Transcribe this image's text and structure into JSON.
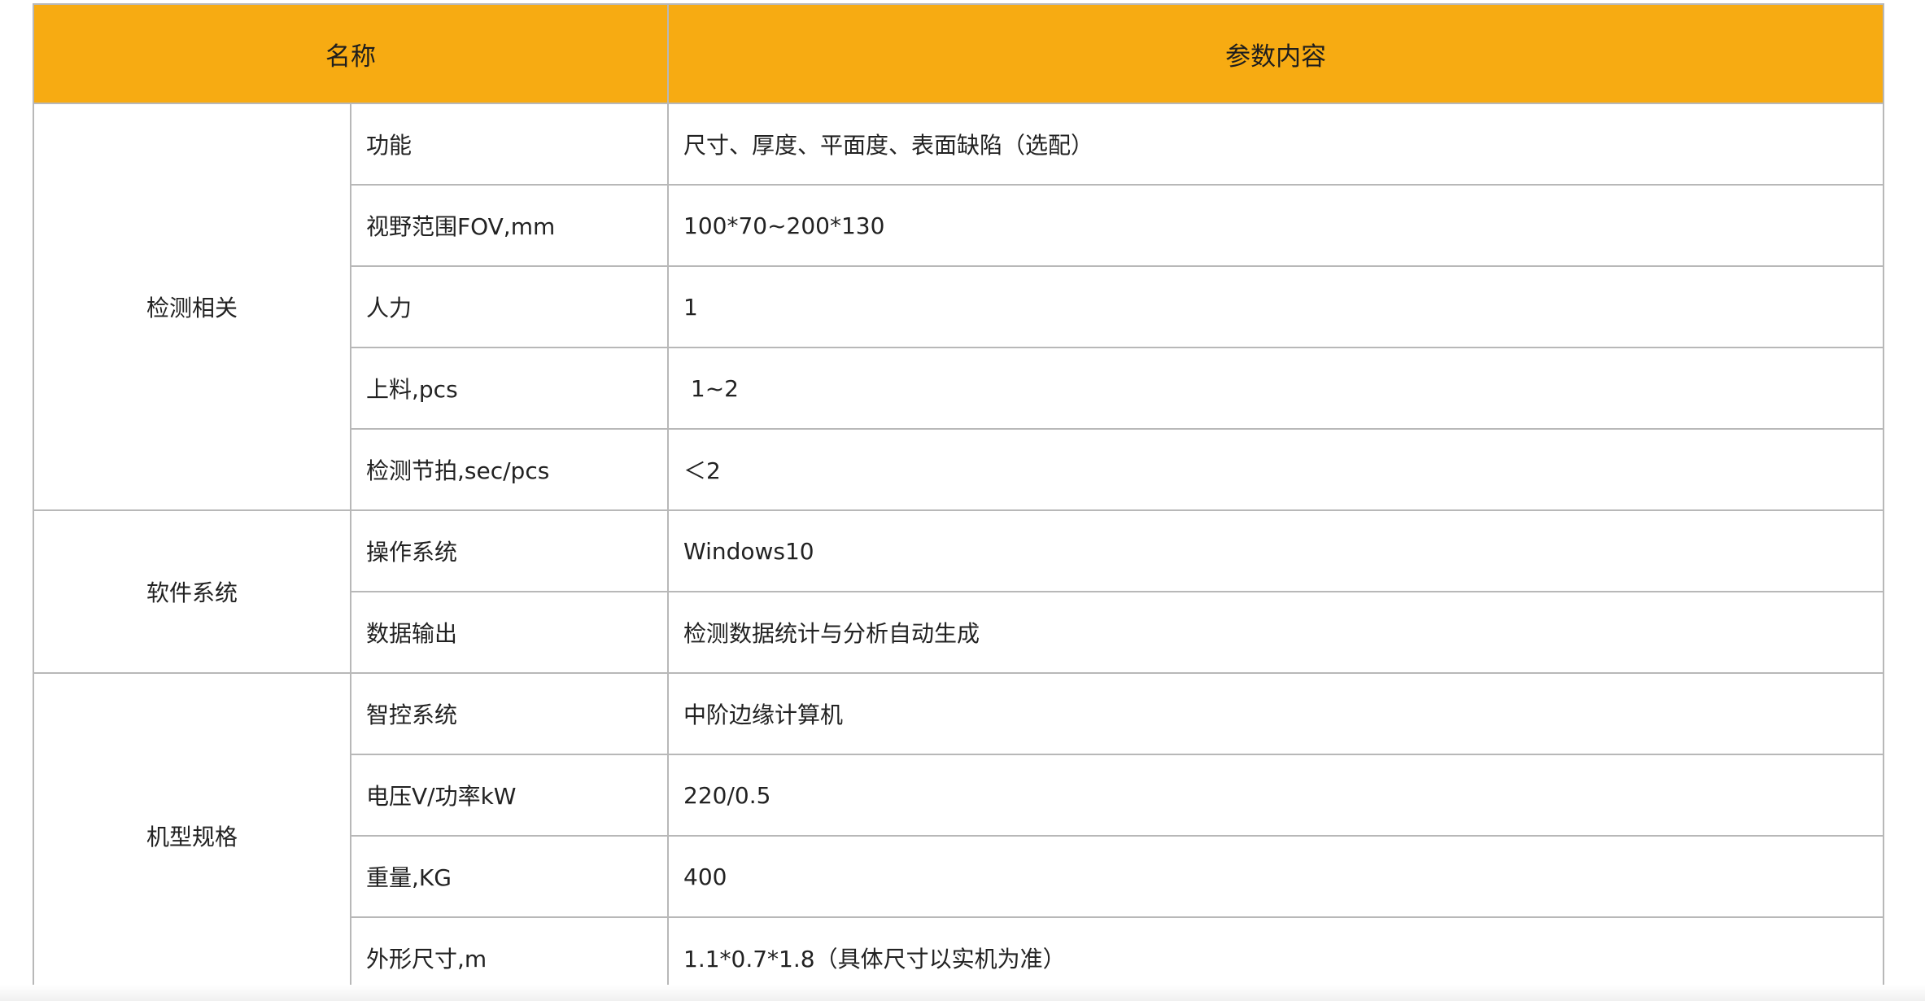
{
  "header": {
    "name_label": "名称",
    "content_label": "参数内容"
  },
  "groups": [
    {
      "label": "检测相关",
      "rows": [
        {
          "param": "功能",
          "value": "尺寸、厚度、平面度、表面缺陷（选配）"
        },
        {
          "param": "视野范围FOV,mm",
          "value": "100*70~200*130"
        },
        {
          "param": "人力",
          "value": "1"
        },
        {
          "param": "上料,pcs",
          "value": " 1~2"
        },
        {
          "param": "检测节拍,sec/pcs",
          "value": "＜2"
        }
      ]
    },
    {
      "label": "软件系统",
      "rows": [
        {
          "param": "操作系统",
          "value": "Windows10"
        },
        {
          "param": "数据输出",
          "value": "检测数据统计与分析自动生成"
        }
      ]
    },
    {
      "label": "机型规格",
      "rows": [
        {
          "param": "智控系统",
          "value": "中阶边缘计算机"
        },
        {
          "param": "电压V/功率kW",
          "value": "220/0.5"
        },
        {
          "param": "重量,KG",
          "value": "400"
        },
        {
          "param": "外形尺寸,m",
          "value": "1.1*0.7*1.8（具体尺寸以实机为准）"
        }
      ]
    }
  ],
  "colors": {
    "header_bg": "#f7ab12",
    "border": "#b8b8b8",
    "text": "#222222"
  }
}
